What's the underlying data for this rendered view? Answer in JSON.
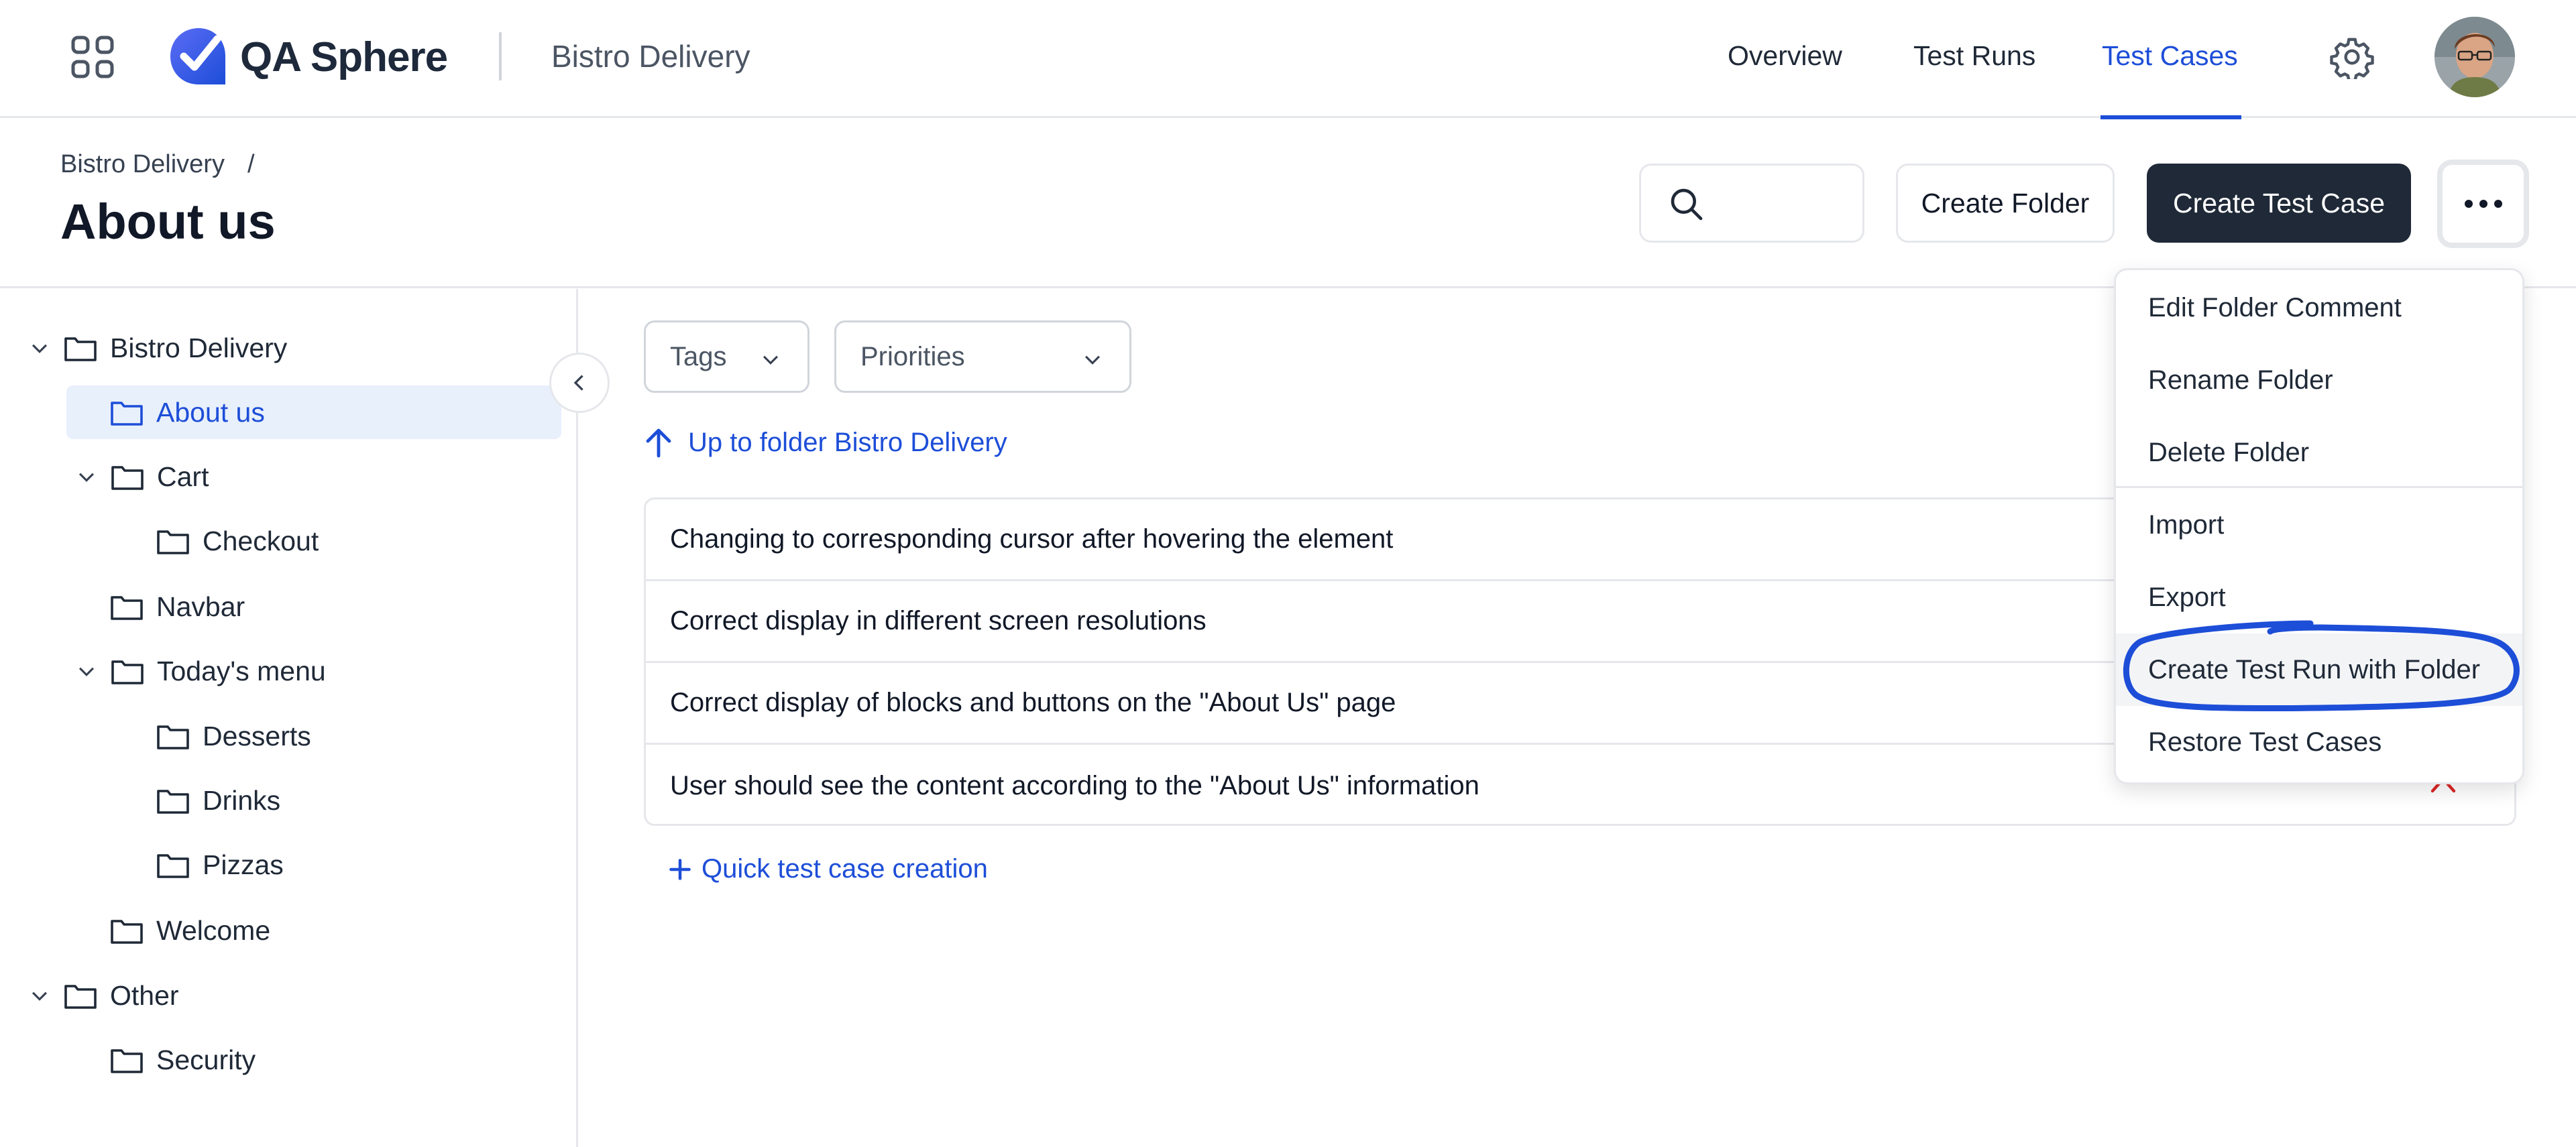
{
  "topbar": {
    "brand": "QA Sphere",
    "project": "Bistro Delivery",
    "nav": [
      {
        "label": "Overview",
        "active": false
      },
      {
        "label": "Test Runs",
        "active": false
      },
      {
        "label": "Test Cases",
        "active": true
      }
    ],
    "accent": "#1d4ed8"
  },
  "header": {
    "breadcrumb": [
      "Bistro Delivery",
      "/"
    ],
    "title": "About us",
    "search": {
      "placeholder": "",
      "value": ""
    },
    "create_folder_label": "Create Folder",
    "create_test_case_label": "Create Test Case"
  },
  "sidebar": {
    "tree": [
      {
        "label": "Bistro Delivery",
        "expanded": true,
        "level": 0
      },
      {
        "label": "About us",
        "selected": true,
        "level": 1
      },
      {
        "label": "Cart",
        "expanded": true,
        "level": 1
      },
      {
        "label": "Checkout",
        "level": 2
      },
      {
        "label": "Navbar",
        "level": 1
      },
      {
        "label": "Today's menu",
        "expanded": true,
        "level": 1
      },
      {
        "label": "Desserts",
        "level": 2
      },
      {
        "label": "Drinks",
        "level": 2
      },
      {
        "label": "Pizzas",
        "level": 2
      },
      {
        "label": "Welcome",
        "level": 1
      },
      {
        "label": "Other",
        "expanded": true,
        "level": 0
      },
      {
        "label": "Security",
        "level": 1
      }
    ]
  },
  "main": {
    "filters": {
      "tags": "Tags",
      "priorities": "Priorities"
    },
    "up_link": "Up to folder Bistro Delivery",
    "test_cases": [
      "Changing to corresponding cursor after hovering the element",
      "Correct display in different screen resolutions",
      "Correct display of blocks and buttons on the \"About Us\" page",
      "User should see the content according to the \"About Us\" information"
    ],
    "quick_create": "Quick test case creation"
  },
  "menu": {
    "items": [
      "Edit Folder Comment",
      "Rename Folder",
      "Delete Folder",
      "Import",
      "Export",
      "Create Test Run with Folder",
      "Restore Test Cases"
    ],
    "highlighted": "Create Test Run with Folder"
  }
}
